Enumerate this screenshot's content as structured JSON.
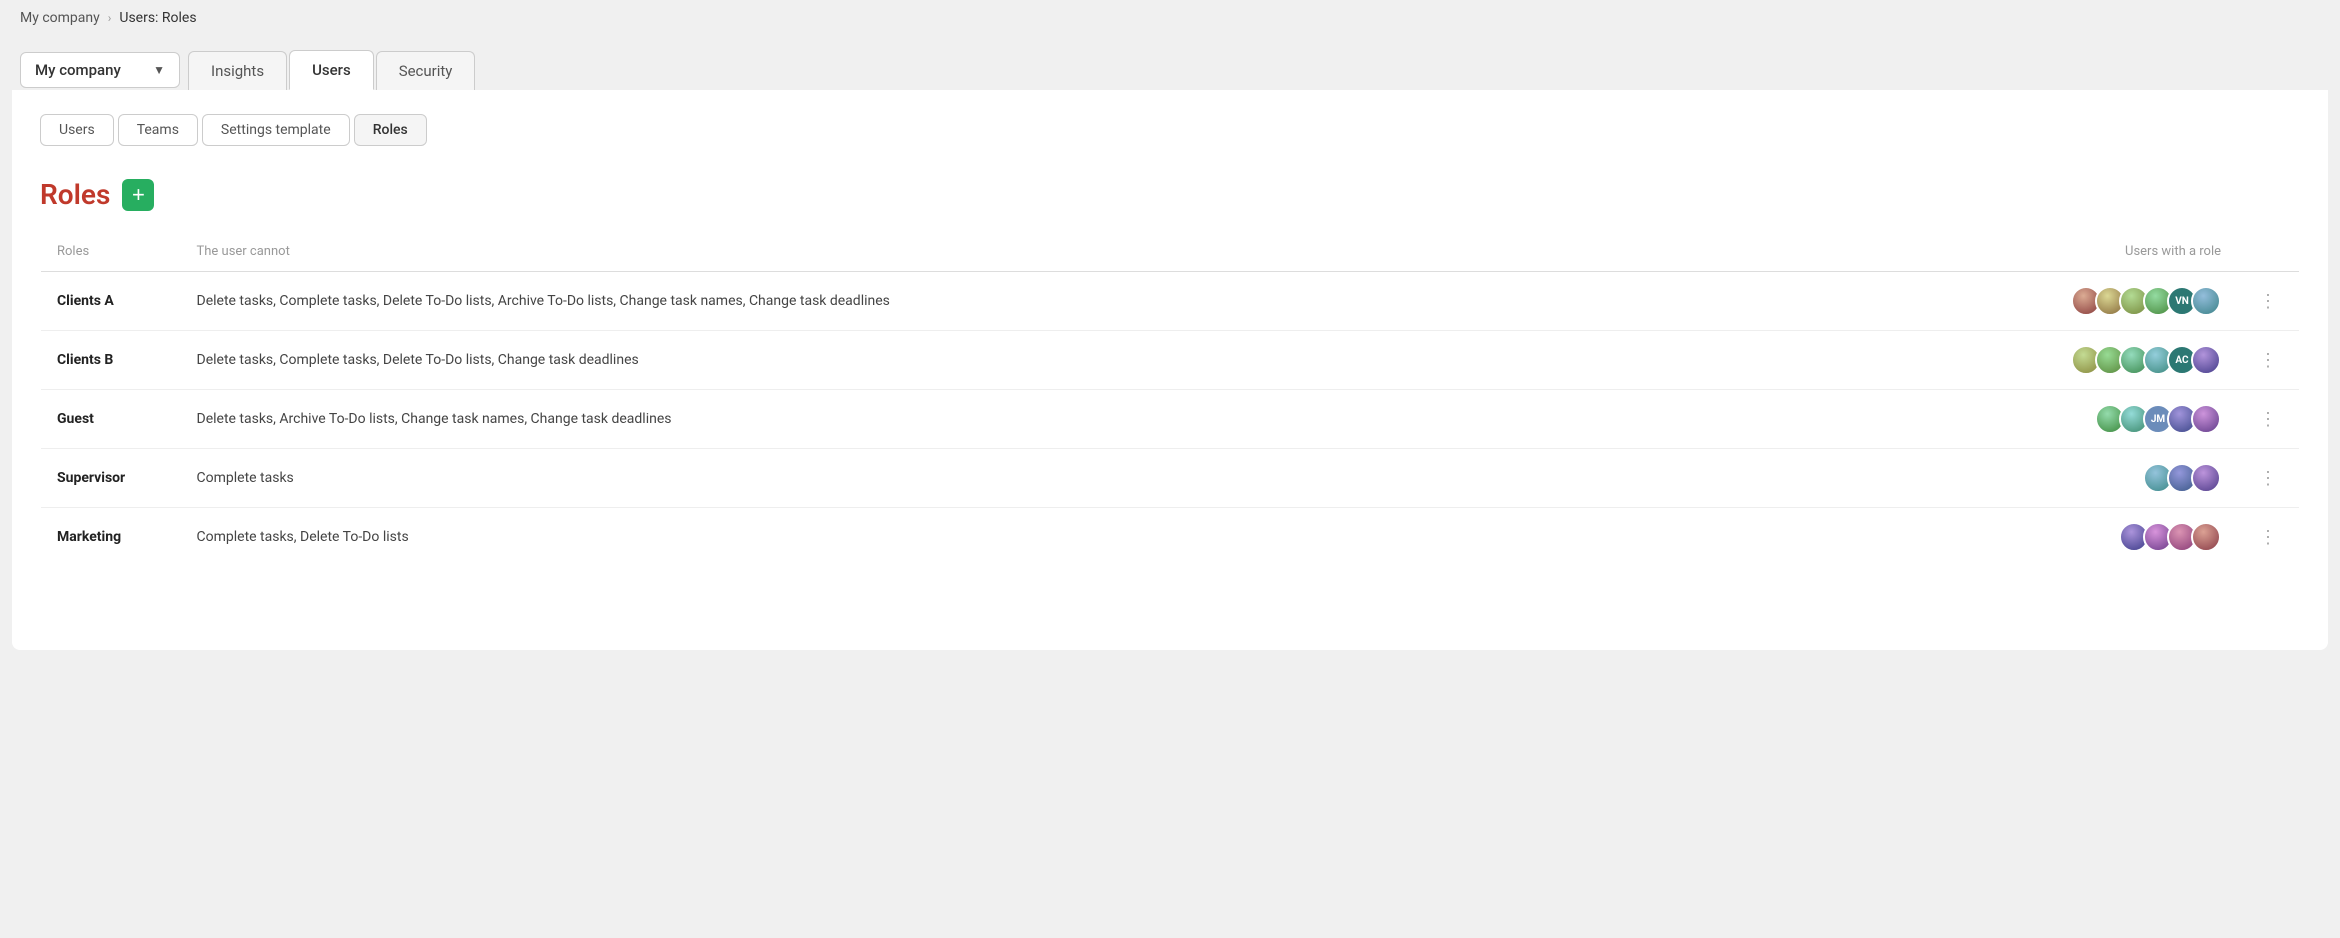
{
  "breadcrumb": {
    "link_label": "My company",
    "separator": "›",
    "current": "Users: Roles"
  },
  "header": {
    "company_select_label": "My company",
    "tabs": [
      {
        "id": "insights",
        "label": "Insights",
        "active": false
      },
      {
        "id": "users",
        "label": "Users",
        "active": true
      },
      {
        "id": "security",
        "label": "Security",
        "active": false
      }
    ]
  },
  "sub_tabs": [
    {
      "id": "users",
      "label": "Users",
      "active": false
    },
    {
      "id": "teams",
      "label": "Teams",
      "active": false
    },
    {
      "id": "settings-template",
      "label": "Settings template",
      "active": false
    },
    {
      "id": "roles",
      "label": "Roles",
      "active": true
    }
  ],
  "roles_section": {
    "title": "Roles",
    "add_button_label": "+",
    "table": {
      "col_roles": "Roles",
      "col_cannot": "The user cannot",
      "col_users": "Users with a role",
      "rows": [
        {
          "role": "Clients A",
          "cannot": "Delete tasks, Complete tasks, Delete To-Do lists, Archive To-Do lists, Change task names, Change task deadlines",
          "avatars": [
            {
              "color": "#7b4f3a",
              "initials": ""
            },
            {
              "color": "#8b5e52",
              "initials": ""
            },
            {
              "color": "#c0392b",
              "initials": ""
            },
            {
              "color": "#5a4a6b",
              "initials": ""
            },
            {
              "color": "#2c7873",
              "initials": "VN"
            },
            {
              "color": "#7d8a6a",
              "initials": ""
            }
          ]
        },
        {
          "role": "Clients B",
          "cannot": "Delete tasks, Complete tasks, Delete To-Do lists, Change task deadlines",
          "avatars": [
            {
              "color": "#8b7355",
              "initials": ""
            },
            {
              "color": "#b87333",
              "initials": ""
            },
            {
              "color": "#7a6a8a",
              "initials": ""
            },
            {
              "color": "#c4a86a",
              "initials": ""
            },
            {
              "color": "#2c7873",
              "initials": "AC"
            },
            {
              "color": "#c49a6c",
              "initials": ""
            }
          ]
        },
        {
          "role": "Guest",
          "cannot": "Delete tasks, Archive To-Do lists, Change task names, Change task deadlines",
          "avatars": [
            {
              "color": "#7b4f3a",
              "initials": ""
            },
            {
              "color": "#b87333",
              "initials": ""
            },
            {
              "color": "#6b8cba",
              "initials": "JM"
            },
            {
              "color": "#c4a86a",
              "initials": ""
            },
            {
              "color": "#e8a020",
              "initials": ""
            }
          ]
        },
        {
          "role": "Supervisor",
          "cannot": "Complete tasks",
          "avatars": [
            {
              "color": "#7b4f3a",
              "initials": ""
            },
            {
              "color": "#6b8cba",
              "initials": ""
            },
            {
              "color": "#2c7873",
              "initials": ""
            }
          ]
        },
        {
          "role": "Marketing",
          "cannot": "Complete tasks, Delete To-Do lists",
          "avatars": [
            {
              "color": "#7b4f3a",
              "initials": ""
            },
            {
              "color": "#8b5e52",
              "initials": ""
            },
            {
              "color": "#6b8cba",
              "initials": ""
            },
            {
              "color": "#7d8a5a",
              "initials": ""
            }
          ]
        }
      ]
    }
  },
  "colors": {
    "accent_red": "#c0392b",
    "accent_green": "#27ae60"
  }
}
